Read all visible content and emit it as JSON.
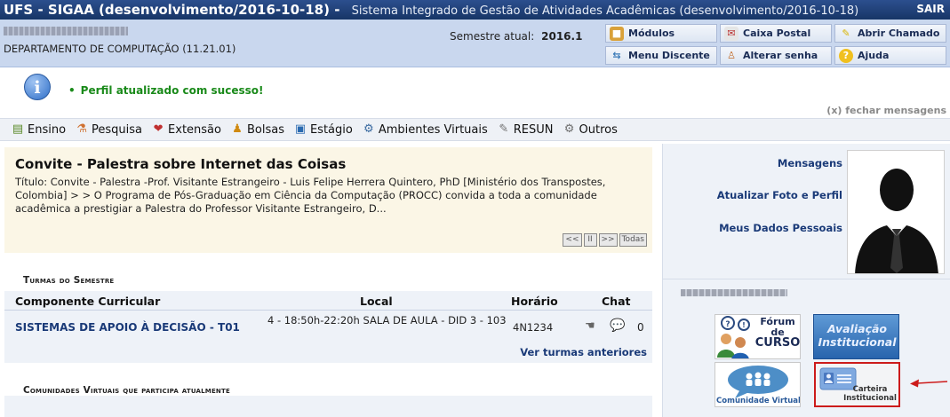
{
  "header": {
    "system_name": "UFS - SIGAA (desenvolvimento/2016-10-18) -",
    "system_fullname": "Sistema Integrado de Gestão de Atividades Acadêmicas (desenvolvimento/2016-10-18)",
    "sair_label": "SAIR"
  },
  "info": {
    "department": "DEPARTAMENTO DE COMPUTAÇÃO (11.21.01)",
    "semester_label": "Semestre atual:",
    "semester_value": "2016.1"
  },
  "quick_buttons": {
    "modulos": "Módulos",
    "caixa_postal": "Caixa Postal",
    "abrir_chamado": "Abrir Chamado",
    "menu_discente": "Menu Discente",
    "alterar_senha": "Alterar senha",
    "ajuda": "Ajuda"
  },
  "message": {
    "text": "Perfil atualizado com sucesso!",
    "close_label": "(x) fechar mensagens"
  },
  "menu": {
    "items": [
      "Ensino",
      "Pesquisa",
      "Extensão",
      "Bolsas",
      "Estágio",
      "Ambientes Virtuais",
      "RESUN",
      "Outros"
    ]
  },
  "news": {
    "title": "Convite - Palestra sobre Internet das Coisas",
    "body": "Título: Convite - Palestra -Prof. Visitante Estrangeiro - Luis Felipe Herrera Quintero, PhD [Ministério dos Transpostes, Colombia] > > O Programa de Pós-Graduação em Ciência da Computação (PROCC) convida a toda a comunidade acadêmica a prestigiar a Palestra do Professor Visitante Estrangeiro, D...",
    "controls": {
      "prev": "<<",
      "pause": "II",
      "next": ">>",
      "all": "Todas"
    }
  },
  "turmas": {
    "section_title": "Turmas do Semestre",
    "headers": {
      "componente": "Componente Curricular",
      "local": "Local",
      "horario": "Horário",
      "chat": "Chat"
    },
    "rows": [
      {
        "componente": "SISTEMAS DE APOIO À DECISÃO - T01",
        "local": "4 - 18:50h-22:20h SALA DE AULA - DID 3 - 103",
        "horario": "4N1234",
        "chat_count": "0"
      }
    ],
    "ver_anteriores": "Ver turmas anteriores"
  },
  "comunidades": {
    "section_title": "Comunidades Virtuais que participa atualmente"
  },
  "profile": {
    "mensagens": "Mensagens",
    "atualizar_foto": "Atualizar Foto e Perfil",
    "meus_dados": "Meus Dados Pessoais"
  },
  "tiles": {
    "forum_line1": "Fórum",
    "forum_line2": "de",
    "forum_line3": "CURSO",
    "avaliacao_line1": "Avaliação",
    "avaliacao_line2": "Institucional",
    "comunidade": "Comunidade Virtual",
    "carteira_line1": "Carteira",
    "carteira_line2": "Institucional"
  },
  "colors": {
    "header_blue": "#1e3f78",
    "info_bar": "#c9d7ee",
    "success_green": "#1a8a1a",
    "link_blue": "#1a3a78",
    "highlight_red": "#cc1b1b"
  }
}
